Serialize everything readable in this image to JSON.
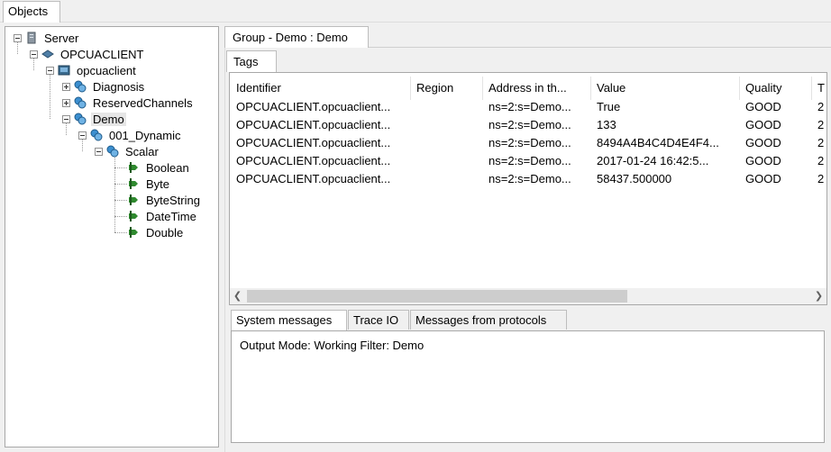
{
  "top_tab": {
    "label": "Objects"
  },
  "tree": {
    "server": "Server",
    "opcuaclient_root": "OPCUACLIENT",
    "opcuaclient": "opcuaclient",
    "diagnosis": "Diagnosis",
    "reserved_channels": "ReservedChannels",
    "demo": "Demo",
    "dynamic": "001_Dynamic",
    "scalar": "Scalar",
    "leaves": [
      "Boolean",
      "Byte",
      "ByteString",
      "DateTime",
      "Double"
    ]
  },
  "group_tab": {
    "label": "Group - Demo : Demo"
  },
  "tags_tab": {
    "label": "Tags"
  },
  "table": {
    "columns": [
      "Identifier",
      "Region",
      "Address in th...",
      "Value",
      "Quality",
      "T"
    ],
    "rows": [
      [
        "OPCUACLIENT.opcuaclient...",
        "",
        "ns=2:s=Demo...",
        "True",
        "GOOD",
        "2"
      ],
      [
        "OPCUACLIENT.opcuaclient...",
        "",
        "ns=2:s=Demo...",
        "133",
        "GOOD",
        "2"
      ],
      [
        "OPCUACLIENT.opcuaclient...",
        "",
        "ns=2:s=Demo...",
        "8494A4B4C4D4E4F4...",
        "GOOD",
        "2"
      ],
      [
        "OPCUACLIENT.opcuaclient...",
        "",
        "ns=2:s=Demo...",
        "2017-01-24 16:42:5...",
        "GOOD",
        "2"
      ],
      [
        "OPCUACLIENT.opcuaclient...",
        "",
        "ns=2:s=Demo...",
        "58437.500000",
        "GOOD",
        "2"
      ]
    ]
  },
  "messages": {
    "tabs": [
      "System messages",
      "Trace IO",
      "Messages from protocols"
    ],
    "output": "Output Mode: Working Filter: Demo"
  },
  "icons": {
    "server": "server-icon",
    "channel": "network-channel-icon",
    "device": "device-icon",
    "group": "tag-group-icon",
    "tag": "tag-icon",
    "scroll_left": "chevron-left-icon",
    "scroll_right": "chevron-right-icon"
  },
  "colors": {
    "group_icon": "#3c8fd0",
    "tag_icon": "#2f8a2f",
    "selection": "#e6e6e6"
  }
}
